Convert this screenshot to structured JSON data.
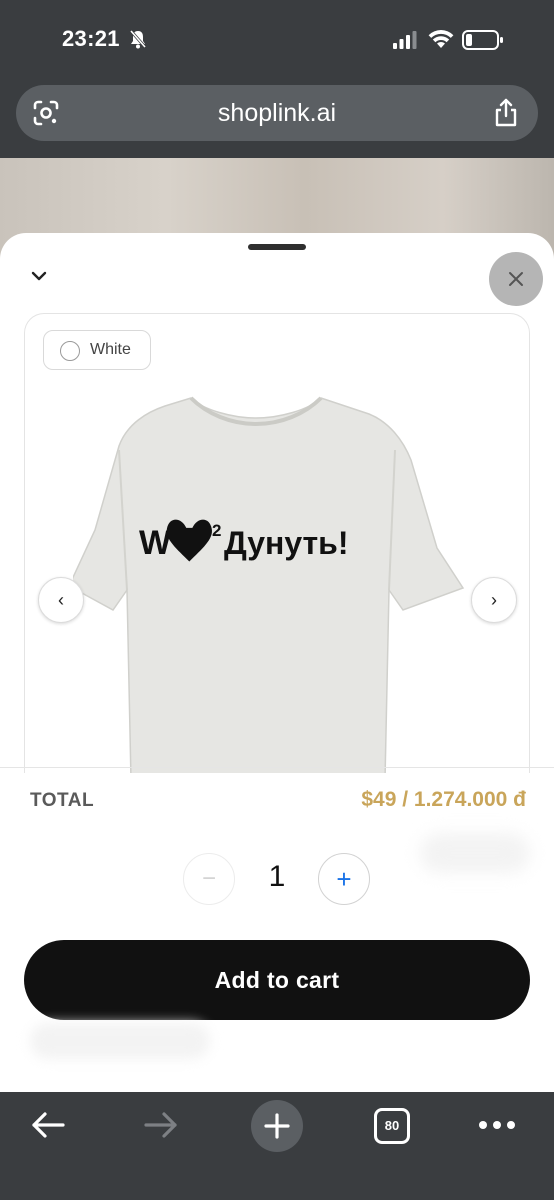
{
  "status_bar": {
    "time": "23:21"
  },
  "browser": {
    "url": "shoplink.ai",
    "tab_count": "80"
  },
  "product": {
    "variant": "White",
    "print_text_prefix": "W",
    "print_text_sup": "2",
    "print_text_main": "Дунуть!",
    "prev_label": "‹",
    "next_label": "›"
  },
  "summary": {
    "total_label": "TOTAL",
    "total_price": "$49 / 1.274.000 đ",
    "quantity": "1",
    "minus_label": "−",
    "plus_label": "+"
  },
  "cta": {
    "add_to_cart": "Add to cart"
  },
  "colors": {
    "accent_gold": "#c9a55a",
    "cta_bg": "#111111",
    "plus_blue": "#1a73e8"
  }
}
